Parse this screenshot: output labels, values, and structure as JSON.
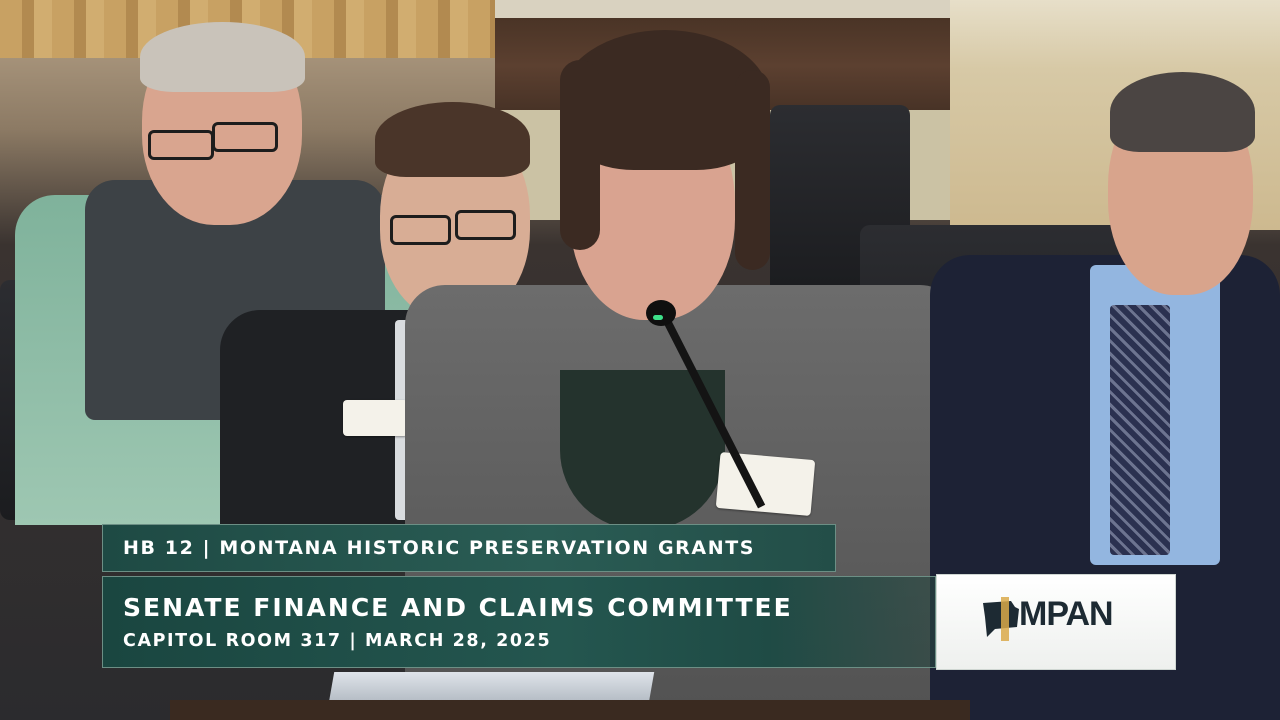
{
  "broadcast": {
    "bill_line": "HB 12 | MONTANA HISTORIC PRESERVATION GRANTS",
    "committee_title": "SENATE FINANCE AND CLAIMS COMMITTEE",
    "location_date": "CAPITOL ROOM 317 | MARCH 28, 2025"
  },
  "logo": {
    "text": "MPAN",
    "icon": "montana-state-shape-icon"
  },
  "colors": {
    "banner_teal": "#24564f",
    "banner_border": "#6c8f85",
    "logo_text": "#1d2a33",
    "mic_led": "#3ee08a"
  }
}
